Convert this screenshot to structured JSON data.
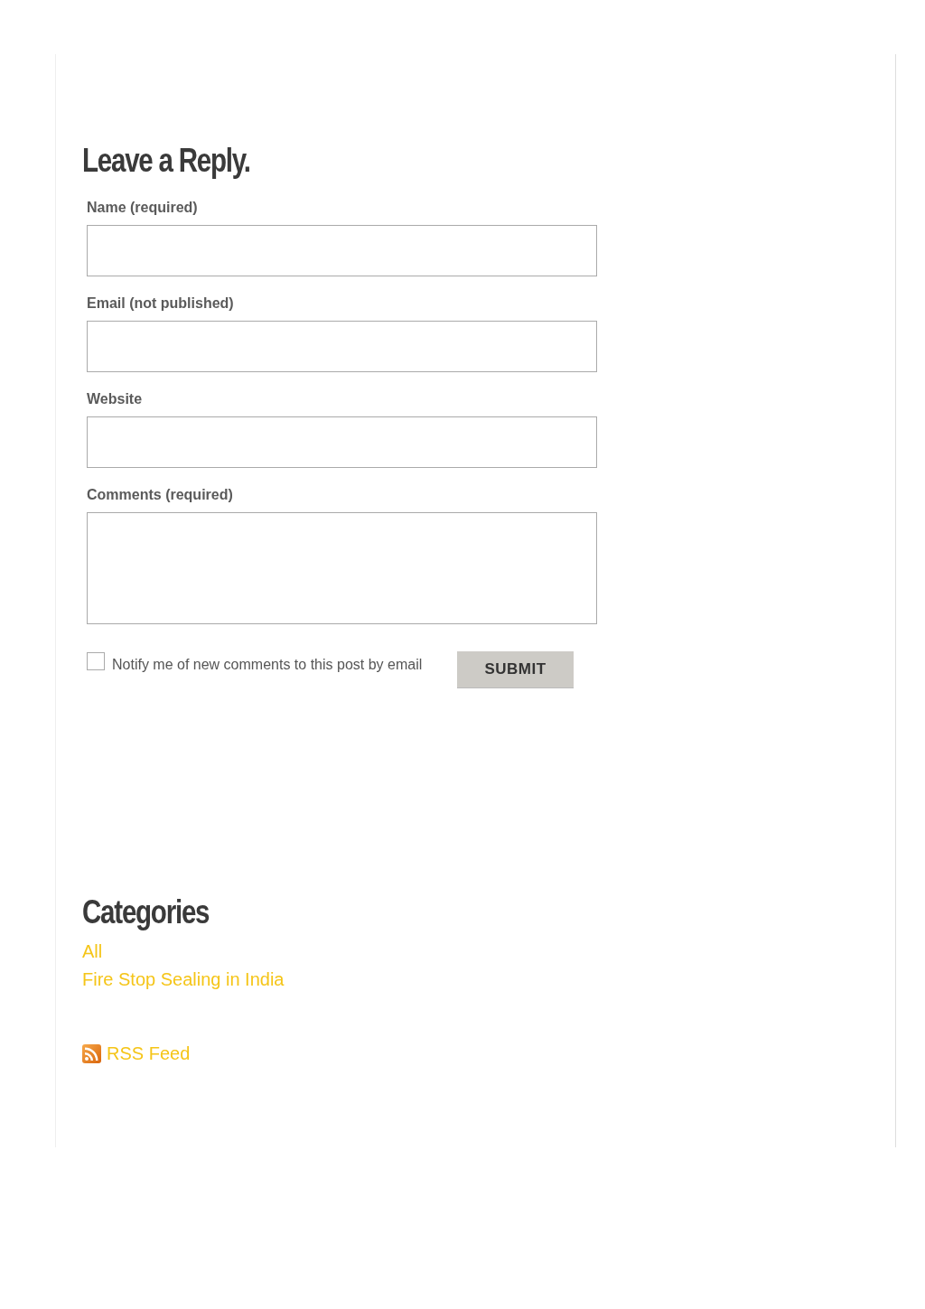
{
  "reply_form": {
    "title": "Leave a Reply.",
    "fields": [
      {
        "label": "Name (required)",
        "kind": "input"
      },
      {
        "label": "Email (not published)",
        "kind": "input"
      },
      {
        "label": "Website",
        "kind": "input"
      },
      {
        "label": "Comments (required)",
        "kind": "textarea"
      }
    ],
    "notify": {
      "label": "Notify me of new comments to this post by email",
      "checked": false
    },
    "submit": "SUBMIT"
  },
  "categories": {
    "title": "Categories",
    "items": [
      "All",
      "Fire Stop Sealing in India"
    ]
  },
  "rss": {
    "label": "RSS Feed"
  }
}
